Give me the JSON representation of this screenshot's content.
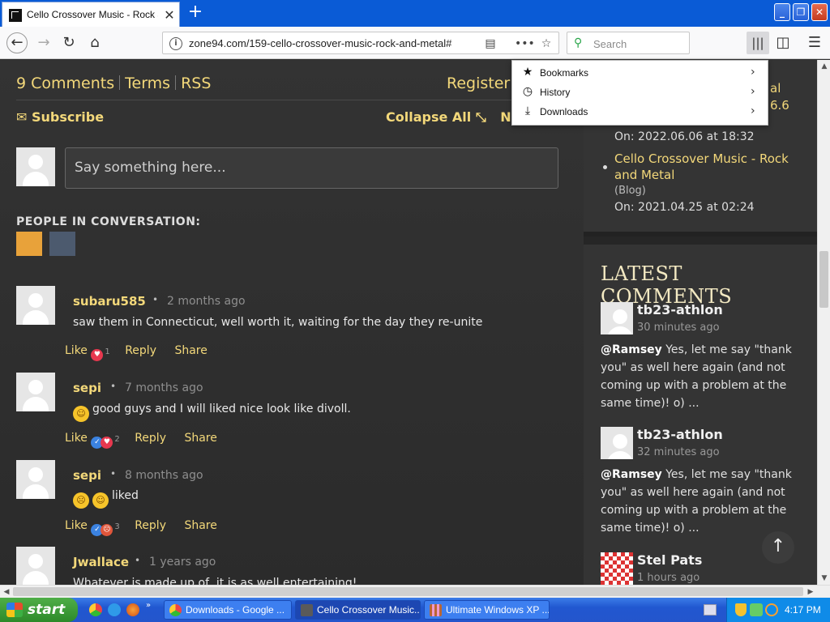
{
  "browser": {
    "tab_title": "Cello Crossover Music - Rock and M",
    "url": "zone94.com/159-cello-crossover-music-rock-and-metal#",
    "search_placeholder": "Search",
    "window_buttons": [
      "_",
      "❐",
      "✕"
    ]
  },
  "library_menu": {
    "items": [
      {
        "label": "Bookmarks",
        "icon": "star-icon"
      },
      {
        "label": "History",
        "icon": "clock-icon"
      },
      {
        "label": "Downloads",
        "icon": "download-icon"
      }
    ]
  },
  "page": {
    "top_links": [
      "9 Comments",
      "Terms",
      "RSS"
    ],
    "register": "Register",
    "subscribe": "Subscribe",
    "collapse_all": "Collapse All",
    "next_partial": "Ne",
    "comment_placeholder": "Say something here...",
    "people_label": "PEOPLE IN CONVERSATION:",
    "comments": [
      {
        "author": "subaru585",
        "time": "2 months ago",
        "text": "saw them in Connecticut, well worth it, waiting for the day they re-unite",
        "like": "Like",
        "count": "1",
        "reply": "Reply",
        "share": "Share"
      },
      {
        "author": "sepi",
        "time": "7 months ago",
        "text": "good guys and I will liked nice look like divoll.",
        "like": "Like",
        "count": "2",
        "reply": "Reply",
        "share": "Share"
      },
      {
        "author": "sepi",
        "time": "8 months ago",
        "text": "liked",
        "like": "Like",
        "count": "3",
        "reply": "Reply",
        "share": "Share"
      },
      {
        "author": "Jwallace",
        "time": "1 years ago",
        "text": "Whatever is made up of, it is as well entertaining!"
      }
    ]
  },
  "sidebar": {
    "partial_lines": [
      "al",
      "6.6"
    ],
    "first_date": "On: 2022.06.06 at 18:32",
    "post_link": "Cello Crossover Music - Rock and Metal",
    "post_category": "(Blog)",
    "post_date": "On: 2021.04.25 at 02:24",
    "latest_title": "LATEST COMMENTS",
    "latest": [
      {
        "author": "tb23-athlon",
        "time": "30 minutes ago",
        "mention": "@Ramsey",
        "text": " Yes, let me say \"thank you\" as well here again (and not coming up with a problem at the same time)! o) ..."
      },
      {
        "author": "tb23-athlon",
        "time": "32 minutes ago",
        "mention": "@Ramsey",
        "text": " Yes, let me say \"thank you\" as well here again (and not coming up with a problem at the same time)! o) ..."
      },
      {
        "author": "Stel Pats",
        "time": "1 hours ago"
      }
    ]
  },
  "taskbar": {
    "start": "start",
    "tasks": [
      "Downloads - Google ...",
      "Cello Crossover Music...",
      "Ultimate Windows XP ..."
    ],
    "clock": "4:17 PM"
  }
}
